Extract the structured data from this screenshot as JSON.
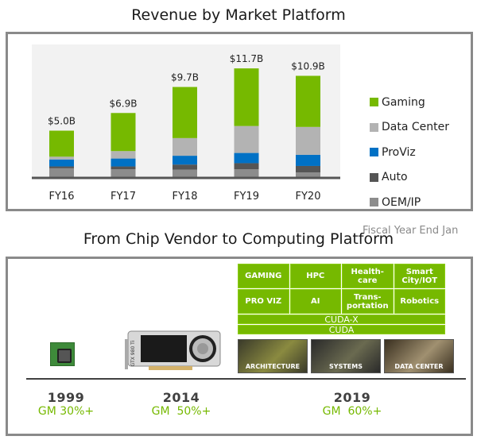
{
  "chart_data": {
    "type": "bar",
    "stacked": true,
    "title": "Revenue by Market Platform",
    "xlabel": "",
    "ylabel": "",
    "note": "Fiscal Year End Jan",
    "categories": [
      "FY16",
      "FY17",
      "FY18",
      "FY19",
      "FY20"
    ],
    "totals": [
      "$5.0B",
      "$6.9B",
      "$9.7B",
      "$11.7B",
      "$10.9B"
    ],
    "total_values": [
      5.0,
      6.9,
      9.7,
      11.7,
      10.9
    ],
    "unit": "$B",
    "ylim": [
      0,
      12.5
    ],
    "grid": false,
    "legend_position": "right",
    "series": [
      {
        "name": "OEM/IP",
        "color": "#8c8c8c",
        "values": [
          0.95,
          0.85,
          0.8,
          0.85,
          0.5
        ]
      },
      {
        "name": "Auto",
        "color": "#555555",
        "values": [
          0.2,
          0.3,
          0.55,
          0.65,
          0.7
        ]
      },
      {
        "name": "ProViz",
        "color": "#0071c5",
        "values": [
          0.75,
          0.85,
          0.95,
          1.1,
          1.2
        ]
      },
      {
        "name": "Data Center",
        "color": "#b3b3b3",
        "values": [
          0.3,
          0.8,
          1.9,
          2.9,
          3.0
        ]
      },
      {
        "name": "Gaming",
        "color": "#76b900",
        "values": [
          2.8,
          4.1,
          5.5,
          6.2,
          5.5
        ]
      }
    ],
    "legend": [
      {
        "name": "Gaming",
        "color": "#76b900"
      },
      {
        "name": "Data Center",
        "color": "#b3b3b3"
      },
      {
        "name": "ProViz",
        "color": "#0071c5"
      },
      {
        "name": "Auto",
        "color": "#555555"
      },
      {
        "name": "OEM/IP",
        "color": "#8c8c8c"
      }
    ]
  },
  "diagram": {
    "title": "From Chip Vendor to Computing Platform",
    "milestones": [
      {
        "year": "1999",
        "gm": "GM 30%+",
        "image": "chip-icon"
      },
      {
        "year": "2014",
        "gm": "GM  50%+",
        "image": "gpu-card-icon",
        "card_text": "GTX 980 Ti"
      },
      {
        "year": "2019",
        "gm": "GM  60%+",
        "image": "platform-stack"
      }
    ],
    "platform_grid": [
      [
        "GAMING",
        "HPC",
        "Health-\ncare",
        "Smart\nCity/IOT"
      ],
      [
        "PRO VIZ",
        "AI",
        "Trans-\nportation",
        "Robotics"
      ]
    ],
    "layers": [
      "CUDA-X",
      "CUDA"
    ],
    "tiles": [
      "ARCHITECTURE",
      "SYSTEMS",
      "DATA CENTER"
    ],
    "accent_color": "#76b900"
  }
}
